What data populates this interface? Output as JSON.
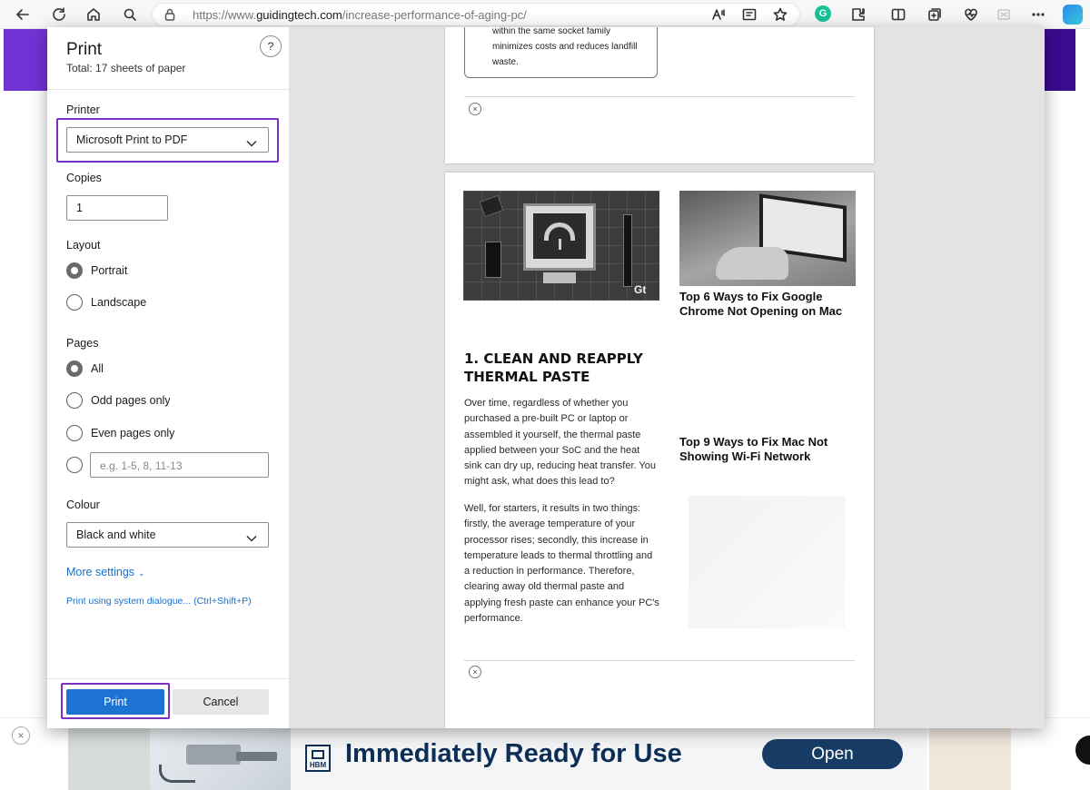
{
  "browser": {
    "url_prefix": "https://www.",
    "url_domain": "guidingtech.com",
    "url_path": "/increase-performance-of-aging-pc/",
    "grammarly_letter": "G"
  },
  "print": {
    "title": "Print",
    "total": "Total: 17 sheets of paper",
    "help": "?",
    "printer_label": "Printer",
    "printer_value": "Microsoft Print to PDF",
    "copies_label": "Copies",
    "copies_value": "1",
    "layout_label": "Layout",
    "layout_options": [
      "Portrait",
      "Landscape"
    ],
    "layout_selected": "Portrait",
    "pages_label": "Pages",
    "pages_options": [
      "All",
      "Odd pages only",
      "Even pages only"
    ],
    "pages_selected": "All",
    "pages_custom_placeholder": "e.g. 1-5, 8, 11-13",
    "colour_label": "Colour",
    "colour_value": "Black and white",
    "more_settings": "More settings",
    "system_dialog": "Print using system dialogue... (Ctrl+Shift+P)",
    "print_button": "Print",
    "cancel_button": "Cancel"
  },
  "preview": {
    "page1_card_lines": [
      "within the same socket family",
      "minimizes costs and reduces landfill",
      "waste."
    ],
    "close_glyph": "×",
    "hero_watermark": "Gt",
    "heading_line1": "1. CLEAN AND REAPPLY",
    "heading_line2": "THERMAL PASTE",
    "para1": "Over time, regardless of whether you purchased a pre-built PC or laptop or assembled it yourself, the thermal paste applied between your SoC and the heat sink can dry up, reducing heat transfer. You might ask, what does this lead to?",
    "para2": "Well, for starters, it results in two things: firstly, the average temperature of your processor rises; secondly, this increase in temperature leads to thermal throttling and a reduction in performance. Therefore, clearing away old thermal paste and applying fresh paste can enhance your PC's performance.",
    "side_title_1": "Top 6 Ways to Fix Google Chrome Not Opening on Mac",
    "side_title_2": "Top 9 Ways to Fix Mac Not Showing Wi-Fi Network"
  },
  "ad": {
    "logo_text": "HBM",
    "headline": "Immediately Ready for Use",
    "cta": "Open",
    "close_glyph": "×"
  },
  "colors": {
    "accent": "#1d73d1",
    "highlight": "#7b2fbe",
    "ad_navy": "#173d66"
  }
}
